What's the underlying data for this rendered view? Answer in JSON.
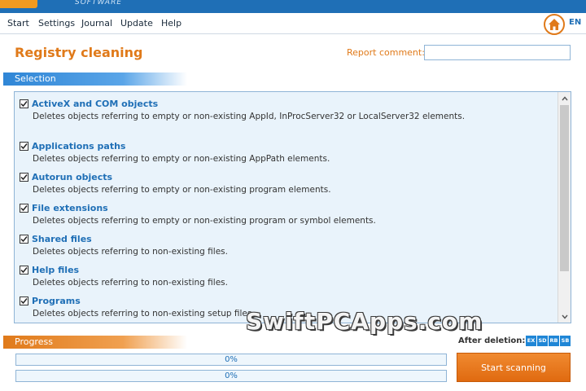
{
  "menu": {
    "items": [
      {
        "label": "Start"
      },
      {
        "label": "Settings"
      },
      {
        "label": "Journal"
      },
      {
        "label": "Update"
      },
      {
        "label": "Help"
      }
    ],
    "lang": "EN"
  },
  "brand": {
    "sub": "SOFTWARE"
  },
  "header": {
    "title": "Registry cleaning",
    "report_label": "Report comment:",
    "report_value": ""
  },
  "selection": {
    "section_label": "Selection",
    "items": [
      {
        "title": "ActiveX and COM objects",
        "desc": "Deletes objects referring to empty or non-existing AppId, InProcServer32 or LocalServer32 elements.",
        "checked": true
      },
      {
        "title": "Applications paths",
        "desc": "Deletes objects referring to empty or non-existing AppPath elements.",
        "checked": true
      },
      {
        "title": "Autorun objects",
        "desc": "Deletes objects referring to empty or non-existing program elements.",
        "checked": true
      },
      {
        "title": "File extensions",
        "desc": "Deletes objects referring to empty or non-existing program or symbol elements.",
        "checked": true
      },
      {
        "title": "Shared files",
        "desc": "Deletes objects referring to non-existing files.",
        "checked": true
      },
      {
        "title": "Help files",
        "desc": "Deletes objects referring to non-existing files.",
        "checked": true
      },
      {
        "title": "Programs",
        "desc": "Deletes objects referring to non-existing setup files.",
        "checked": true
      }
    ]
  },
  "progress": {
    "section_label": "Progress",
    "bars": [
      {
        "text": "0%",
        "value": 0
      },
      {
        "text": "0%",
        "value": 0
      }
    ],
    "after_deletion_label": "After deletion:",
    "badges": [
      "EX",
      "SD",
      "RB",
      "SB"
    ],
    "start_label": "Start scanning"
  },
  "watermark": "SwiftPCApps.com",
  "colors": {
    "accent_orange": "#e07a1a",
    "accent_blue": "#1f6fb6",
    "list_bg": "#e9f3fb"
  }
}
